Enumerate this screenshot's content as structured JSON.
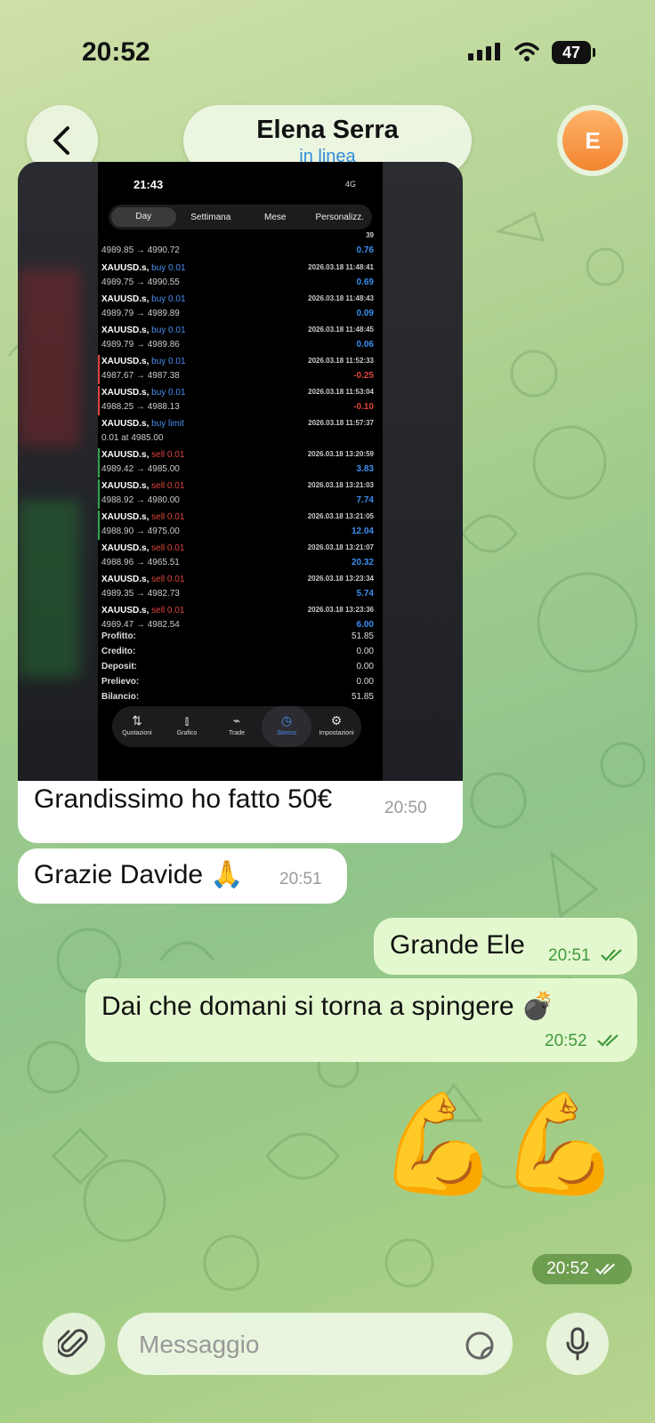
{
  "status_bar": {
    "time": "20:52",
    "battery": "47"
  },
  "header": {
    "contact_name": "Elena Serra",
    "status": "in linea",
    "avatar_letter": "E"
  },
  "shared_screenshot": {
    "time": "21:43",
    "network": "4G",
    "tabs": [
      "Day",
      "Settimana",
      "Mese",
      "Personalizz."
    ],
    "partial_row": {
      "prices": "4989.85 → 4990.72",
      "profit": "0.76",
      "time_fragment": "39"
    },
    "trades": [
      {
        "symbol": "XAUUSD.s,",
        "side": "buy 0.01",
        "datetime": "2026.03.18 11:48:41",
        "prices": "4989.75 → 4990.55",
        "profit": "0.69"
      },
      {
        "symbol": "XAUUSD.s,",
        "side": "buy 0.01",
        "datetime": "2026.03.18 11:48:43",
        "prices": "4989.79 → 4989.89",
        "profit": "0.09"
      },
      {
        "symbol": "XAUUSD.s,",
        "side": "buy 0.01",
        "datetime": "2026.03.18 11:48:45",
        "prices": "4989.79 → 4989.86",
        "profit": "0.06"
      },
      {
        "symbol": "XAUUSD.s,",
        "side": "buy 0.01",
        "datetime": "2026.03.18 11:52:33",
        "prices": "4987.67 → 4987.38",
        "profit": "-0.25"
      },
      {
        "symbol": "XAUUSD.s,",
        "side": "buy 0.01",
        "datetime": "2026.03.18 11:53:04",
        "prices": "4988.25 → 4988.13",
        "profit": "-0.10"
      },
      {
        "symbol": "XAUUSD.s,",
        "side": "buy limit",
        "datetime": "2026.03.18 11:57:37",
        "prices": "0.01 at 4985.00",
        "profit": ""
      },
      {
        "symbol": "XAUUSD.s,",
        "side": "sell 0.01",
        "datetime": "2026.03.18 13:20:59",
        "prices": "4989.42 → 4985.00",
        "profit": "3.83"
      },
      {
        "symbol": "XAUUSD.s,",
        "side": "sell 0.01",
        "datetime": "2026.03.18 13:21:03",
        "prices": "4988.92 → 4980.00",
        "profit": "7.74"
      },
      {
        "symbol": "XAUUSD.s,",
        "side": "sell 0.01",
        "datetime": "2026.03.18 13:21:05",
        "prices": "4988.90 → 4975.00",
        "profit": "12.04"
      },
      {
        "symbol": "XAUUSD.s,",
        "side": "sell 0.01",
        "datetime": "2026.03.18 13:21:07",
        "prices": "4988.96 → 4965.51",
        "profit": "20.32"
      },
      {
        "symbol": "XAUUSD.s,",
        "side": "sell 0.01",
        "datetime": "2026.03.18 13:23:34",
        "prices": "4989.35 → 4982.73",
        "profit": "5.74"
      },
      {
        "symbol": "XAUUSD.s,",
        "side": "sell 0.01",
        "datetime": "2026.03.18 13:23:36",
        "prices": "4989.47 → 4982.54",
        "profit": "6.00"
      }
    ],
    "summary": [
      {
        "label": "Profitto:",
        "value": "51.85"
      },
      {
        "label": "Credito:",
        "value": "0.00"
      },
      {
        "label": "Deposit:",
        "value": "0.00"
      },
      {
        "label": "Prelievo:",
        "value": "0.00"
      },
      {
        "label": "Bilancio:",
        "value": "51.85"
      }
    ],
    "bottom_tabs": [
      "Quotazioni",
      "Grafico",
      "Trade",
      "Storico",
      "Impostazioni"
    ]
  },
  "messages": {
    "m1": {
      "text": "Grandissimo ho fatto 50€",
      "time": "20:50"
    },
    "m2": {
      "text": "Grazie Davide 🙏",
      "time": "20:51"
    },
    "m3": {
      "text": "Grande Ele",
      "time": "20:51"
    },
    "m4": {
      "text": "Dai che domani si torna a spingere 💣",
      "time": "20:52"
    },
    "m5": {
      "emoji": "💪💪",
      "time": "20:52"
    }
  },
  "composer": {
    "placeholder": "Messaggio"
  }
}
